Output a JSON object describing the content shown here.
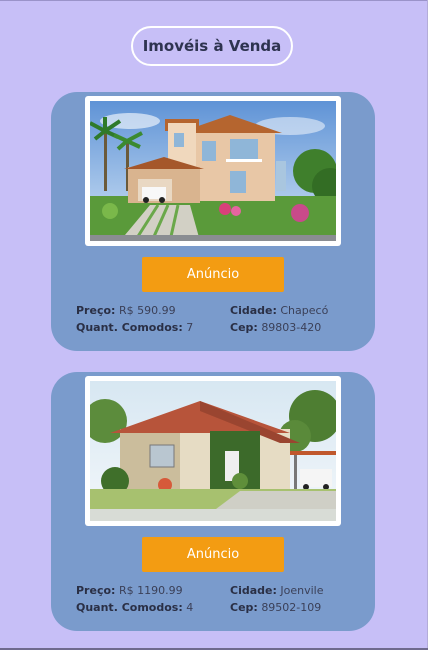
{
  "header": {
    "title": "Imovéis à Venda"
  },
  "listings": [
    {
      "button_label": "Anúncio",
      "price_label": "Preço:",
      "price": "R$ 590.99",
      "rooms_label": "Quant. Comodos:",
      "rooms": "7",
      "city_label": "Cidade:",
      "city": "Chapecó",
      "cep_label": "Cep:",
      "cep": "89803-420"
    },
    {
      "button_label": "Anúncio",
      "price_label": "Preço:",
      "price": "R$ 1190.99",
      "rooms_label": "Quant. Comodos:",
      "rooms": "4",
      "city_label": "Cidade:",
      "city": "Joenvile",
      "cep_label": "Cep:",
      "cep": "89502-109"
    }
  ],
  "colors": {
    "background": "#c7bff7",
    "card": "#7a9bcc",
    "button": "#f39c12",
    "title_text": "#2e3350"
  }
}
